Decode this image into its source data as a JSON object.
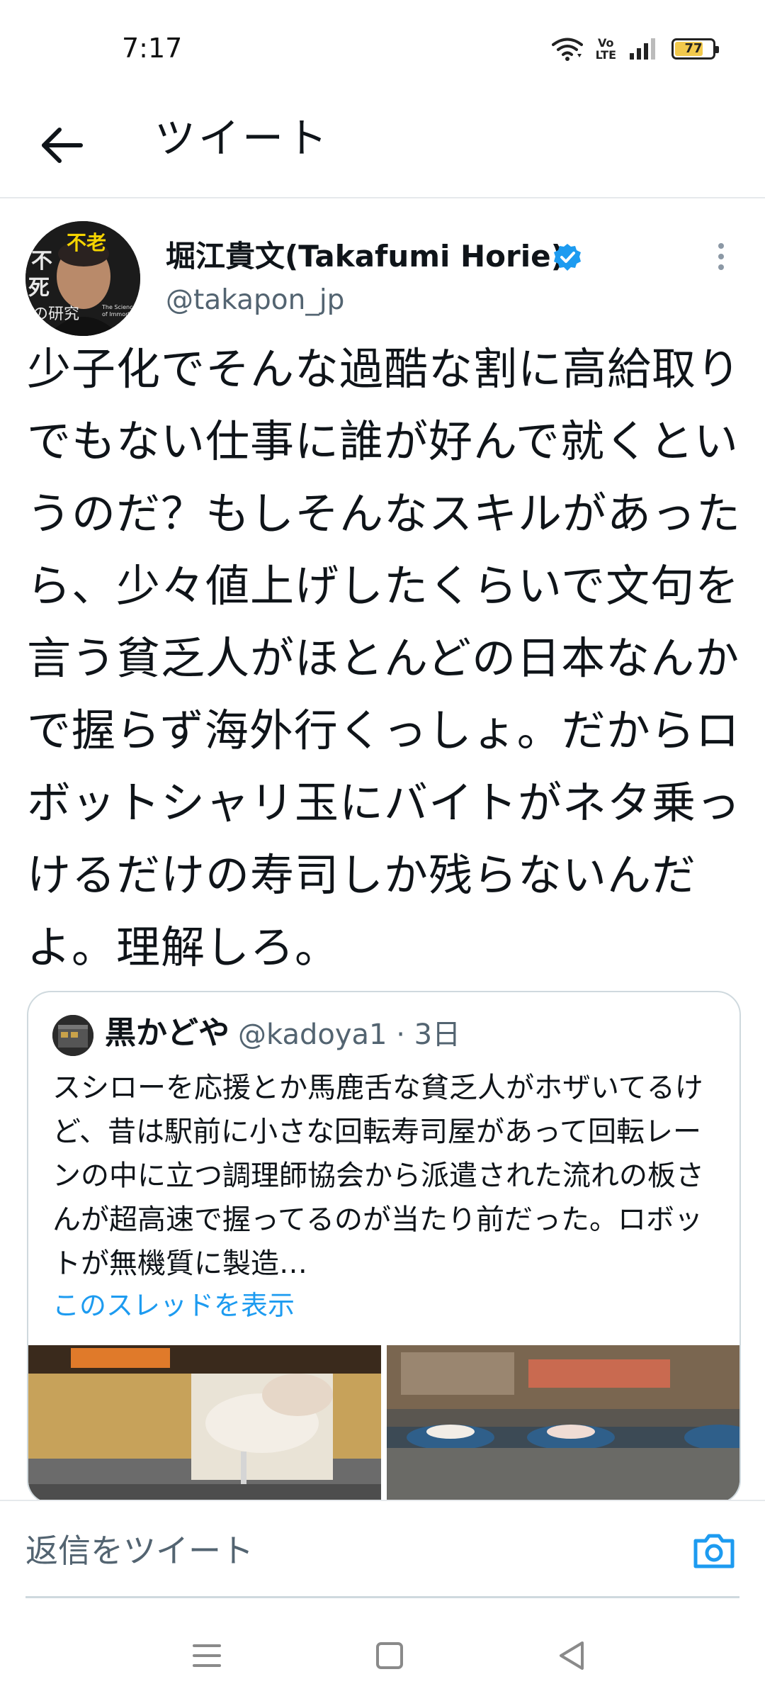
{
  "status_bar": {
    "time": "7:17",
    "volte_label_top": "Vo",
    "volte_label_bottom": "LTE",
    "battery_level": "77",
    "battery_fraction": 0.77
  },
  "header": {
    "title": "ツイート"
  },
  "tweet": {
    "author_name": "堀江貴文(Takafumi Horie)",
    "handle": "@takapon_jp",
    "avatar_book_title": "不死の研究",
    "avatar_book_subtitle": "The Science of Immortality",
    "text": "少子化でそんな過酷な割に高給取りでもない仕事に誰が好んで就くというのだ？もしそんなスキルがあったら、少々値上げしたくらいで文句を言う貧乏人がほとんどの日本なんかで握らず海外行くっしょ。だからロボットシャリ玉にバイトがネタ乗っけるだけの寿司しか残らないんだよ。理解しろ。"
  },
  "quote": {
    "author_name": "黒かどや",
    "handle": "@kadoya1",
    "time": "· 3日",
    "text": "スシローを応援とか馬鹿舌な貧乏人がホザいてるけど、昔は駅前に小さな回転寿司屋があって回転レーンの中に立つ調理師協会から派遣された流れの板さんが超高速で握ってるのが当たり前だった。ロボットが無機質に製造…",
    "show_thread": "このスレッドを表示"
  },
  "reply": {
    "placeholder": "返信をツイート"
  },
  "icons": {
    "back": "arrow-left-icon",
    "verified": "verified-badge-icon",
    "more": "more-vertical-icon",
    "camera": "camera-icon",
    "wifi": "wifi-icon",
    "signal": "signal-icon",
    "battery": "battery-icon",
    "nav_menu": "menu-icon",
    "nav_home": "home-square-icon",
    "nav_back": "back-triangle-icon"
  },
  "colors": {
    "accent": "#1d9bf0",
    "text": "#0f1419",
    "secondary": "#536471",
    "border": "#cfd9de",
    "battery": "#f2c94c"
  }
}
